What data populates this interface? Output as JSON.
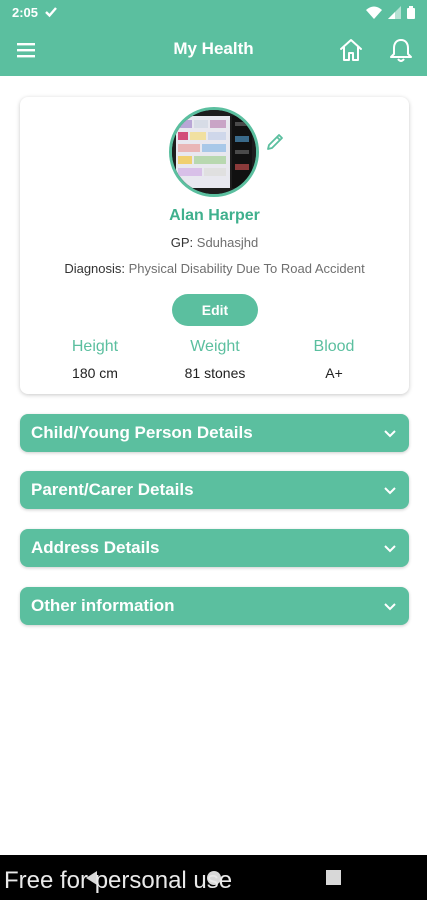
{
  "status_bar": {
    "time": "2:05"
  },
  "app_bar": {
    "title": "My Health"
  },
  "profile": {
    "name": "Alan Harper",
    "gp_label": "GP:",
    "gp_value": "Sduhasjhd",
    "diagnosis_label": "Diagnosis:",
    "diagnosis_value": "Physical Disability Due To Road Accident",
    "edit_label": "Edit",
    "stats": [
      {
        "label": "Height",
        "value": "180 cm"
      },
      {
        "label": "Weight",
        "value": "81 stones"
      },
      {
        "label": "Blood",
        "value": "A+"
      }
    ]
  },
  "sections": [
    {
      "label": "Child/Young Person Details"
    },
    {
      "label": "Parent/Carer Details"
    },
    {
      "label": "Address Details"
    },
    {
      "label": "Other information"
    }
  ],
  "watermark": "Free for personal use",
  "colors": {
    "primary": "#5bbf9f",
    "primary_text": "#3fb08d"
  }
}
